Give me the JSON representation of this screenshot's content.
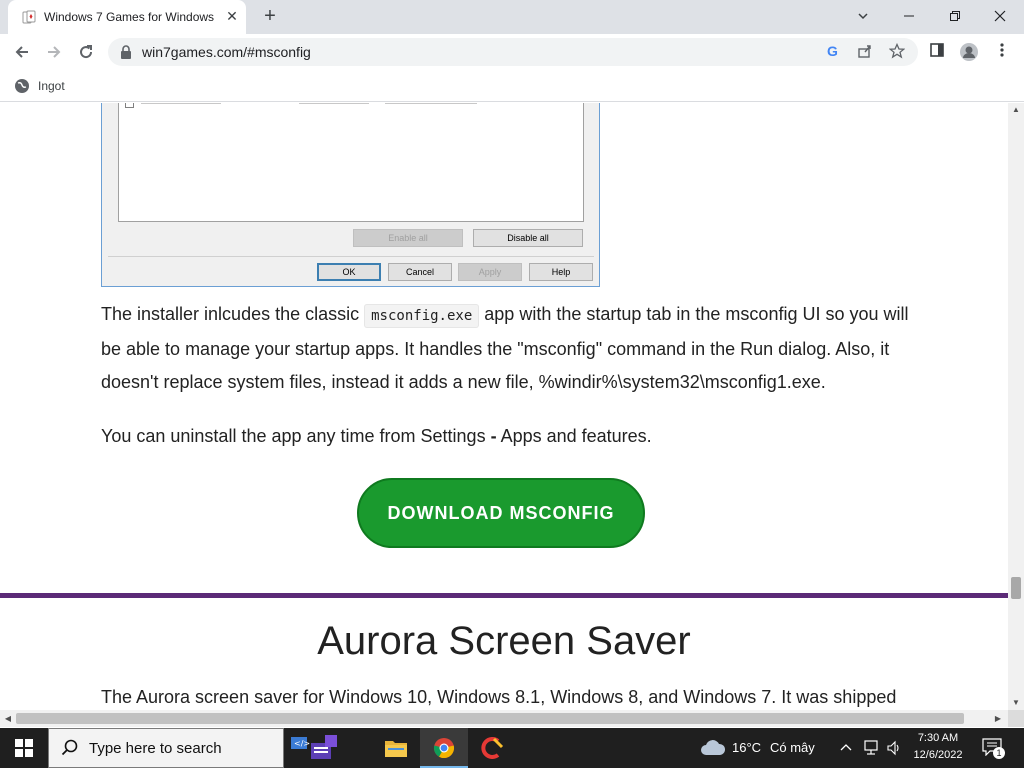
{
  "browser": {
    "tab_title": "Windows 7 Games for Windows",
    "close_glyph": "✕",
    "newtab_glyph": "+",
    "url": "win7games.com/#msconfig",
    "bookmark_label": "Ingot"
  },
  "msconfig_dialog": {
    "buttons": {
      "enable_all": "Enable all",
      "disable_all": "Disable all",
      "ok": "OK",
      "cancel": "Cancel",
      "apply": "Apply",
      "help": "Help"
    }
  },
  "article": {
    "para1_before": "The installer inlcudes the classic ",
    "para1_code": "msconfig.exe",
    "para1_after": " app with the startup tab in the msconfig UI so you will be able to manage your startup apps. It handles the \"msconfig\" command in the Run dialog. Also, it doesn't replace system files, instead it adds a new file, %windir%\\system32\\msconfig1.exe.",
    "para2_before": "You can uninstall the app any time from Settings ",
    "para2_dash": "-",
    "para2_after": " Apps and features.",
    "download_button": "DOWNLOAD MSCONFIG",
    "section_title": "Aurora Screen Saver",
    "para3": "The Aurora screen saver for Windows 10, Windows 8.1, Windows 8, and Windows 7. It was shipped"
  },
  "taskbar": {
    "search_placeholder": "Type here to search",
    "weather_temp": "16°C",
    "weather_desc": "Có mây",
    "time": "7:30 AM",
    "date": "12/6/2022",
    "notification_count": "1"
  },
  "colors": {
    "download_green": "#1a9a2e",
    "divider_purple": "#5b2a77",
    "taskbar_bg": "#1f1f1f"
  }
}
